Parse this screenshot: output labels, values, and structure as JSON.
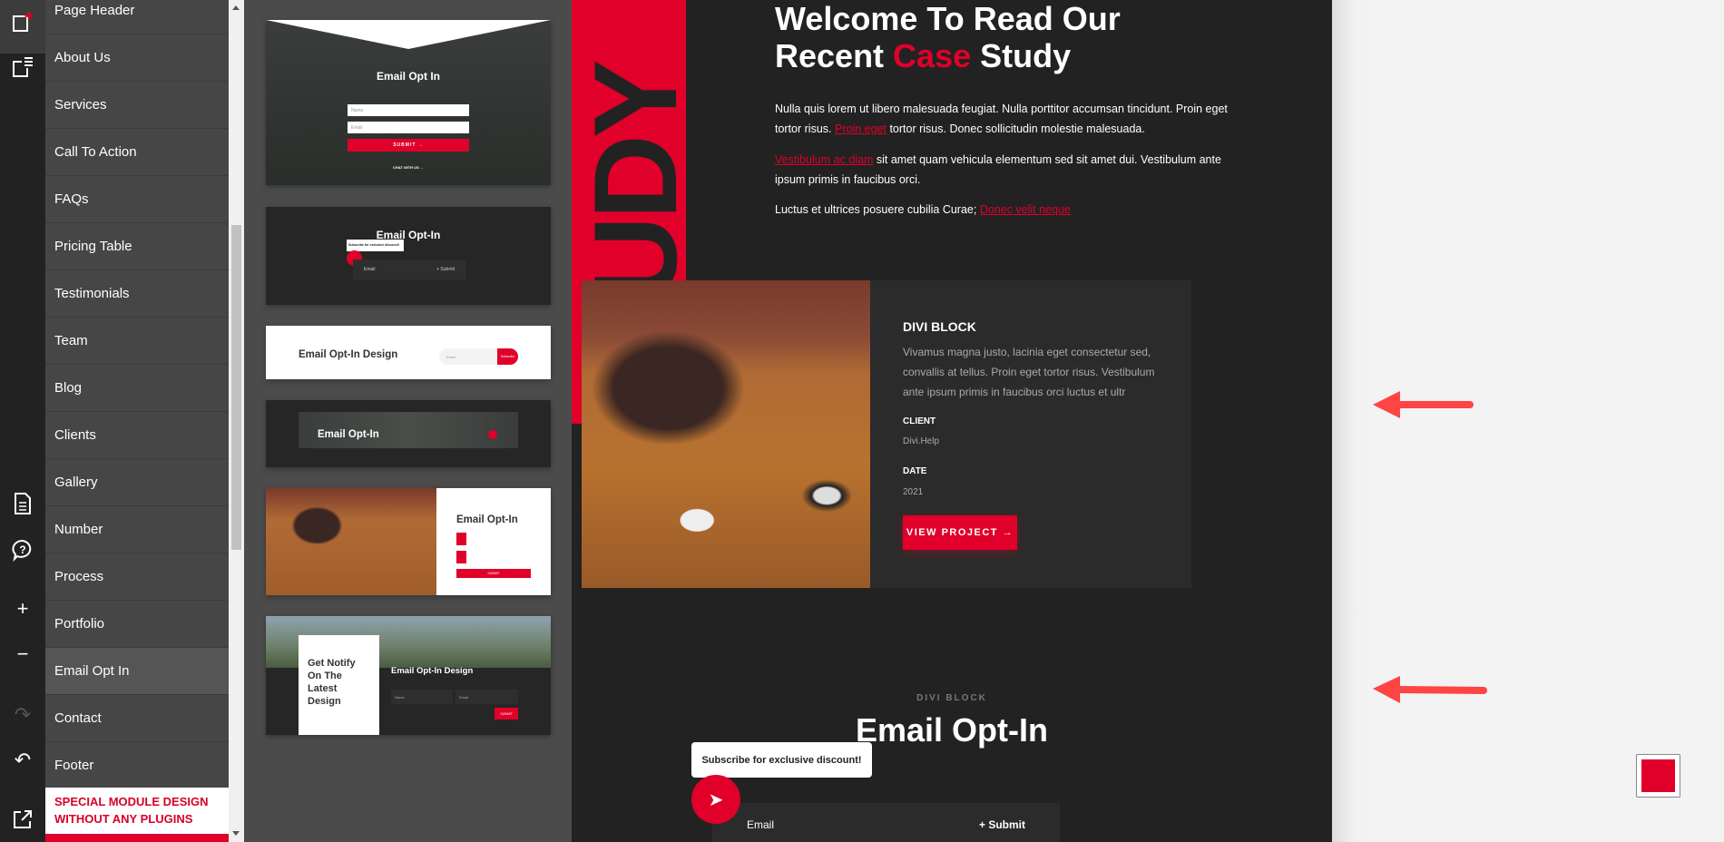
{
  "colors": {
    "accent": "#e0002a",
    "dark": "#222222",
    "panel": "#4b4b4b",
    "sidebar": "#464646"
  },
  "iconbar": [
    {
      "name": "add-page-icon"
    },
    {
      "name": "page-list-icon"
    },
    {
      "name": "document-icon"
    },
    {
      "name": "help-icon"
    },
    {
      "name": "plus-icon"
    },
    {
      "name": "minus-icon"
    },
    {
      "name": "redo-icon"
    },
    {
      "name": "undo-icon"
    },
    {
      "name": "external-link-icon"
    }
  ],
  "sidebar": {
    "items": [
      "Page Header",
      "About Us",
      "Services",
      "Call To Action",
      "FAQs",
      "Pricing Table",
      "Testimonials",
      "Team",
      "Blog",
      "Clients",
      "Gallery",
      "Number",
      "Process",
      "Portfolio",
      "Email Opt In",
      "Contact",
      "Footer"
    ],
    "active": "Email Opt In",
    "special": "SPECIAL MODULE DESIGN WITHOUT ANY PLUGINS"
  },
  "thumbnails": [
    {
      "title": "Email Opt In",
      "name_ph": "Name",
      "email_ph": "Email",
      "button": "SUBMIT →",
      "link": "CHAT WITH US →"
    },
    {
      "title": "Email Opt-In",
      "tooltip": "Subscribe for exclusive discount!",
      "email_ph": "Email",
      "button": "+ Submit"
    },
    {
      "title": "Email Opt-In Design",
      "email_ph": "Email",
      "button": "Subscribe"
    },
    {
      "title": "Email Opt-In"
    },
    {
      "title": "Email Opt-In",
      "button": "SUBMIT"
    },
    {
      "title": "Get Notify On The Latest Design",
      "subtitle": "Email Opt-In Design",
      "name_ph": "Name",
      "email_ph": "Email",
      "button": "SUBMIT"
    }
  ],
  "main": {
    "band_text": "STUDY",
    "heading": {
      "line1": "Welcome To Read Our",
      "pre": "Recent ",
      "accent": "Case",
      "post": " Study"
    },
    "p1": {
      "a": "Nulla quis lorem ut libero malesuada feugiat. Nulla porttitor accumsan tincidunt. Proin eget tortor risus. ",
      "link": "Proin eget",
      "b": " tortor risus. Donec sollicitudin molestie malesuada."
    },
    "p2": {
      "link": "Vestibulum ac diam",
      "b": " sit amet quam vehicula elementum sed sit amet dui. Vestibulum ante ipsum primis in faucibus orci."
    },
    "p3": {
      "a": "Luctus et ultrices posuere cubilia Curae; ",
      "link": "Donec velit neque"
    },
    "card": {
      "title": "DIVI BLOCK",
      "text": "Vivamus magna justo, lacinia eget consectetur sed, convallis at tellus. Proin eget tortor risus. Vestibulum ante ipsum primis in faucibus orci luctus et ultr",
      "client_label": "CLIENT",
      "client": "Divi.Help",
      "date_label": "DATE",
      "date": "2021",
      "button": "VIEW PROJECT →"
    },
    "optin": {
      "eyebrow": "DIVI BLOCK",
      "title": "Email Opt-In",
      "tooltip": "Subscribe for exclusive discount!",
      "email_ph": "Email",
      "submit": "+ Submit"
    }
  }
}
